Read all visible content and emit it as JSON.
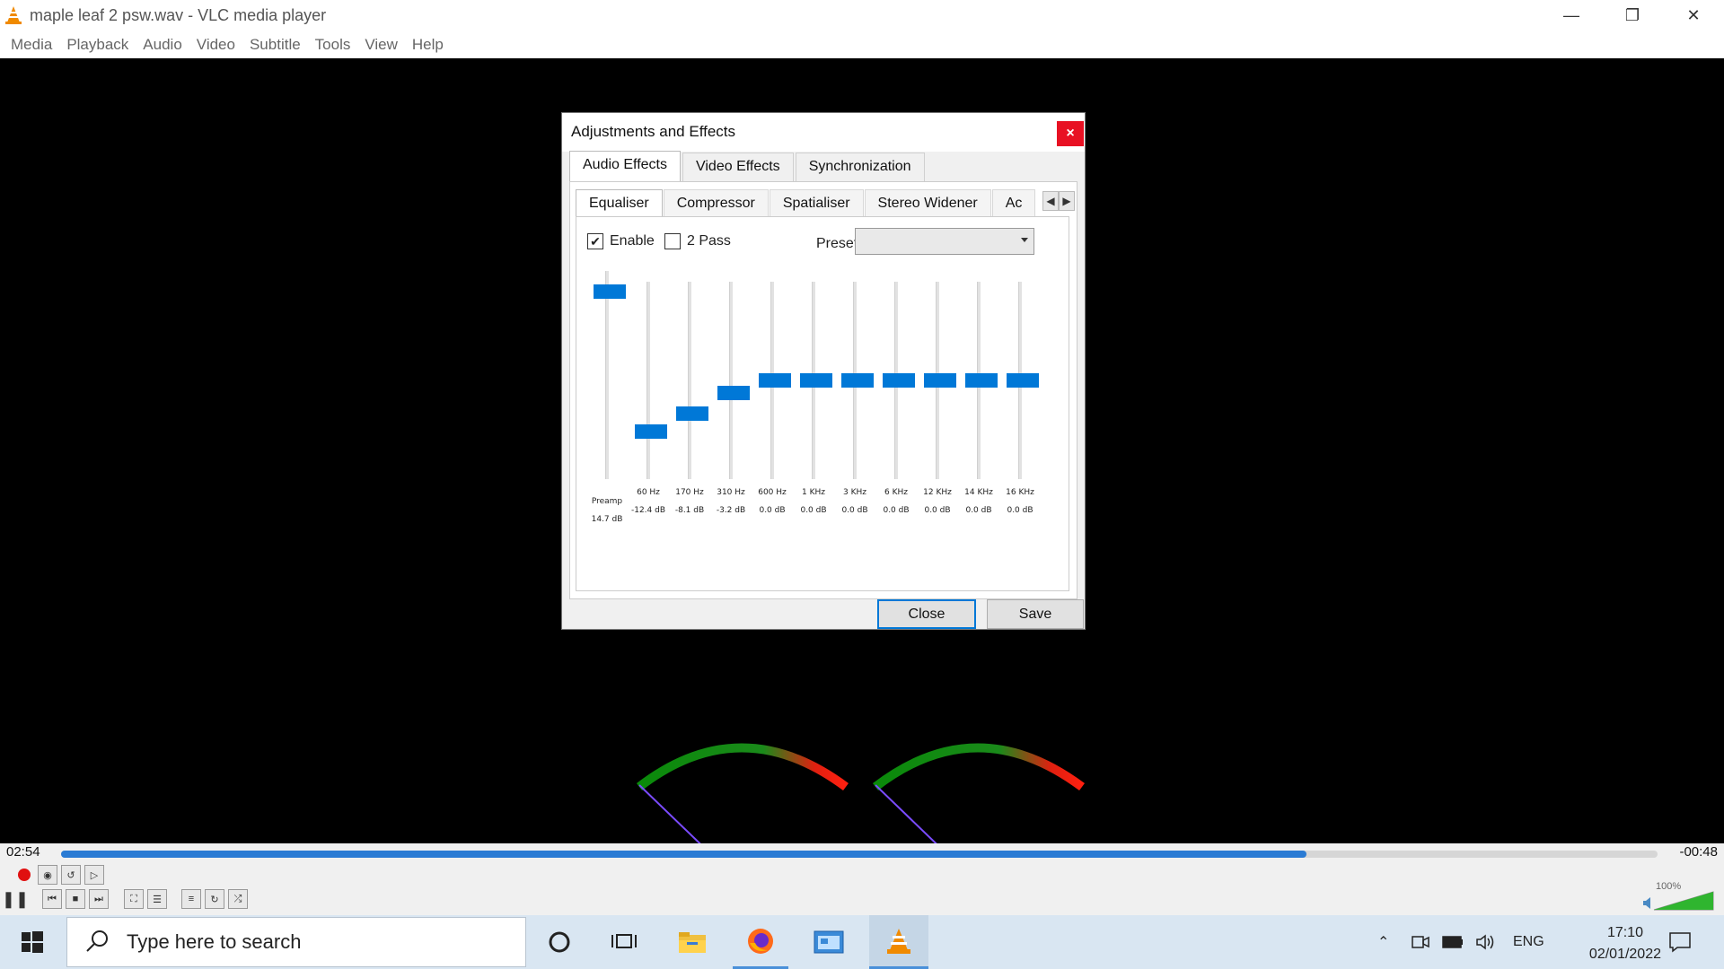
{
  "window": {
    "title": "maple leaf 2 psw.wav - VLC media player",
    "minimize": "—",
    "restore": "❐",
    "close": "✕"
  },
  "menu": [
    "Media",
    "Playback",
    "Audio",
    "Video",
    "Subtitle",
    "Tools",
    "View",
    "Help"
  ],
  "dialog": {
    "title": "Adjustments and Effects",
    "close_x": "×",
    "tabs": [
      "Audio Effects",
      "Video Effects",
      "Synchronization"
    ],
    "subtabs": [
      "Equaliser",
      "Compressor",
      "Spatialiser",
      "Stereo Widener",
      "Ac"
    ],
    "enable_label": "Enable",
    "enable_checked": true,
    "twopass_label": "2 Pass",
    "twopass_checked": false,
    "preset_label": "Preset",
    "preset_value": "",
    "preamp": {
      "label": "Preamp",
      "value": "14.7 dB",
      "level": 0.93
    },
    "bands": [
      {
        "freq": "60 Hz",
        "gain": "-12.4 dB",
        "level": 0.22
      },
      {
        "freq": "170 Hz",
        "gain": "-8.1 dB",
        "level": 0.32
      },
      {
        "freq": "310 Hz",
        "gain": "-3.2 dB",
        "level": 0.43
      },
      {
        "freq": "600 Hz",
        "gain": "0.0 dB",
        "level": 0.5
      },
      {
        "freq": "1 KHz",
        "gain": "0.0 dB",
        "level": 0.5
      },
      {
        "freq": "3 KHz",
        "gain": "0.0 dB",
        "level": 0.5
      },
      {
        "freq": "6 KHz",
        "gain": "0.0 dB",
        "level": 0.5
      },
      {
        "freq": "12 KHz",
        "gain": "0.0 dB",
        "level": 0.5
      },
      {
        "freq": "14 KHz",
        "gain": "0.0 dB",
        "level": 0.5
      },
      {
        "freq": "16 KHz",
        "gain": "0.0 dB",
        "level": 0.5
      }
    ],
    "close_button": "Close",
    "save_button": "Save"
  },
  "player": {
    "elapsed": "02:54",
    "remaining": "-00:48",
    "progress": 0.78,
    "volume_label": "100%",
    "volume": 1.0
  },
  "taskbar": {
    "search_placeholder": "Type here to search",
    "lang": "ENG",
    "time": "17:10",
    "date": "02/01/2022"
  },
  "colors": {
    "accent": "#0078d7",
    "close_red": "#e81123",
    "seek_fill": "#2a7bd4"
  }
}
